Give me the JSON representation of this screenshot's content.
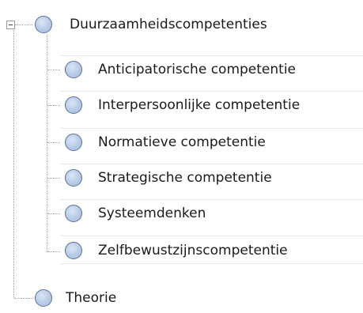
{
  "tree": {
    "root": {
      "label": "Duurzaamheidscompetenties",
      "expanded": true,
      "icon": "circle-node-icon",
      "children": [
        {
          "label": "Anticipatorische competentie"
        },
        {
          "label": "Interpersoonlijke competentie"
        },
        {
          "label": "Normatieve competentie"
        },
        {
          "label": "Strategische competentie"
        },
        {
          "label": "Systeemdenken"
        },
        {
          "label": "Zelfbewustzijnscompetentie"
        }
      ]
    },
    "sibling": {
      "label": "Theorie",
      "icon": "circle-node-icon"
    }
  },
  "colors": {
    "icon_fill": "#b8cae6",
    "icon_border": "#5a7296",
    "connector": "#a0a0a0",
    "row_divider": "#e6e6e6"
  }
}
